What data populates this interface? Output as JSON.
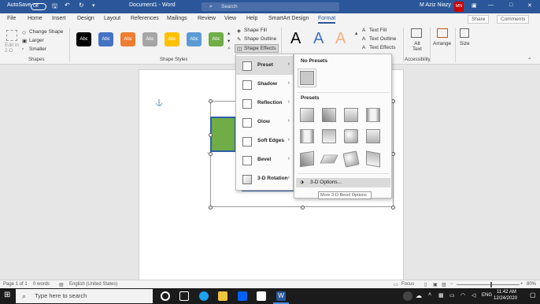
{
  "titlebar": {
    "autosave_label": "AutoSave",
    "autosave_state": "Off",
    "document_title": "Document1 - Word",
    "search_placeholder": "Search",
    "user_name": "M Aziz Niazy",
    "user_initials": "MN"
  },
  "tabs": [
    "File",
    "Home",
    "Insert",
    "Design",
    "Layout",
    "References",
    "Mailings",
    "Review",
    "View",
    "Help",
    "SmartArt Design",
    "Format"
  ],
  "active_tab": "Format",
  "tab_buttons": {
    "share": "Share",
    "comments": "Comments"
  },
  "ribbon": {
    "shapes_group": {
      "edit_in_2d": "Edit in 2-D",
      "change_shape": "Change Shape",
      "larger": "Larger",
      "smaller": "Smaller",
      "label": "Shapes"
    },
    "shape_styles": {
      "swatches": [
        {
          "text": "Abc",
          "color": "#000000"
        },
        {
          "text": "Abc",
          "color": "#4472c4"
        },
        {
          "text": "Abc",
          "color": "#ed7d31"
        },
        {
          "text": "Abc",
          "color": "#a5a5a5"
        },
        {
          "text": "Abc",
          "color": "#ffc000"
        },
        {
          "text": "Abc",
          "color": "#5b9bd5"
        },
        {
          "text": "Abc",
          "color": "#70ad47"
        }
      ],
      "shape_fill": "Shape Fill",
      "shape_outline": "Shape Outline",
      "shape_effects": "Shape Effects",
      "label": "Shape Styles"
    },
    "wordart": {
      "letters": [
        "A",
        "A",
        "A"
      ],
      "text_fill": "Text Fill",
      "text_outline": "Text Outline",
      "text_effects": "Text Effects"
    },
    "accessibility": {
      "alt_text": "Alt Text",
      "label": "Accessibility"
    },
    "arrange": {
      "label": "Arrange"
    },
    "size": {
      "label": "Size"
    }
  },
  "effects_menu": {
    "items": [
      {
        "label": "Preset"
      },
      {
        "label": "Shadow"
      },
      {
        "label": "Reflection"
      },
      {
        "label": "Glow"
      },
      {
        "label": "Soft Edges"
      },
      {
        "label": "Bevel"
      },
      {
        "label": "3-D Rotation"
      }
    ],
    "selected_index": 0
  },
  "preset_gallery": {
    "no_presets_header": "No Presets",
    "presets_header": "Presets",
    "options_label": "3-D Options...",
    "tooltip": "More 3-D Bevel Options"
  },
  "statusbar": {
    "page": "Page 1 of 1",
    "words": "0 words",
    "language": "English (United States)",
    "focus": "Focus",
    "zoom": "80%"
  },
  "taskbar": {
    "search_placeholder": "Type here to search",
    "language": "ENG",
    "time": "11:42 AM",
    "date": "12/24/2020"
  },
  "colors": {
    "accent": "#2b579a",
    "shape_green": "#70ad47",
    "shape_border": "#2e5fa8"
  }
}
